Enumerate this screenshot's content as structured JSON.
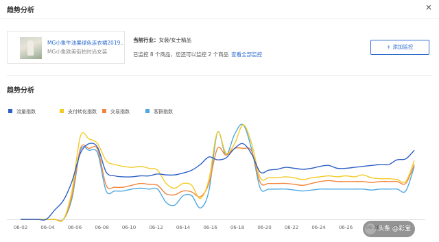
{
  "header": {
    "title": "趋势分析",
    "close_icon": "close-icon"
  },
  "product": {
    "title": "MG小象牛油果绿色连衣裙2019...",
    "shop": "MG小象欧美街拍时尚女装",
    "thumbnail_icon": "product-thumbnail"
  },
  "industry": {
    "label": "当前行业：",
    "value": "女装/女士精品"
  },
  "monitor": {
    "text": "已监控 8 个商品，您还可以监控 2 个商品",
    "link": "查看全部监控"
  },
  "add_button": "+ 添加监控",
  "section_title": "趋势分析",
  "watermark": "头条 @彩宝",
  "chart_data": {
    "type": "line",
    "title": "",
    "xlabel": "",
    "ylabel": "",
    "grid": false,
    "legend_position": "top-left",
    "x_tick_labels": [
      "06-02",
      "06-04",
      "06-06",
      "06-08",
      "06-10",
      "06-12",
      "06-14",
      "06-16",
      "06-18",
      "06-20",
      "06-22",
      "06-24",
      "06-26",
      "06-28",
      "07-01"
    ],
    "ylim": [
      0,
      100
    ],
    "series": [
      {
        "name": "流量指数",
        "color": "#2c5fc7",
        "values": [
          0,
          0,
          0,
          0,
          10,
          20,
          40,
          70,
          80,
          76,
          50,
          46,
          45,
          45,
          46,
          46,
          48,
          47,
          47,
          49,
          52,
          58,
          66,
          63,
          65,
          75,
          80,
          69,
          50,
          52,
          53,
          55,
          54,
          53,
          54,
          56,
          57,
          54,
          54,
          55,
          56,
          57,
          58,
          58,
          63,
          64,
          73
        ]
      },
      {
        "name": "支付转化指数",
        "color": "#f2cb24",
        "values": [
          0,
          0,
          0,
          0,
          0,
          0,
          30,
          88,
          85,
          80,
          62,
          58,
          56,
          55,
          56,
          54,
          52,
          38,
          33,
          38,
          36,
          22,
          42,
          92,
          70,
          80,
          100,
          80,
          44,
          44,
          44,
          45,
          44,
          42,
          44,
          45,
          46,
          45,
          46,
          45,
          47,
          44,
          43,
          43,
          42,
          40,
          62
        ]
      },
      {
        "name": "交易指数",
        "color": "#f2853a",
        "values": [
          0,
          0,
          0,
          0,
          0,
          0,
          25,
          75,
          75,
          74,
          36,
          34,
          34,
          36,
          38,
          37,
          36,
          27,
          26,
          30,
          29,
          24,
          38,
          75,
          68,
          75,
          75,
          72,
          39,
          38,
          38,
          38,
          37,
          36,
          38,
          40,
          41,
          40,
          40,
          40,
          40,
          39,
          40,
          40,
          40,
          38,
          58
        ]
      },
      {
        "name": "客群指数",
        "color": "#4fa8e0",
        "values": [
          0,
          0,
          0,
          0,
          0,
          0,
          22,
          73,
          73,
          70,
          30,
          30,
          30,
          32,
          33,
          32,
          32,
          18,
          15,
          25,
          25,
          12,
          30,
          92,
          68,
          90,
          100,
          74,
          33,
          32,
          32,
          32,
          31,
          30,
          31,
          32,
          32,
          32,
          32,
          32,
          32,
          31,
          32,
          32,
          32,
          30,
          56
        ]
      }
    ]
  }
}
